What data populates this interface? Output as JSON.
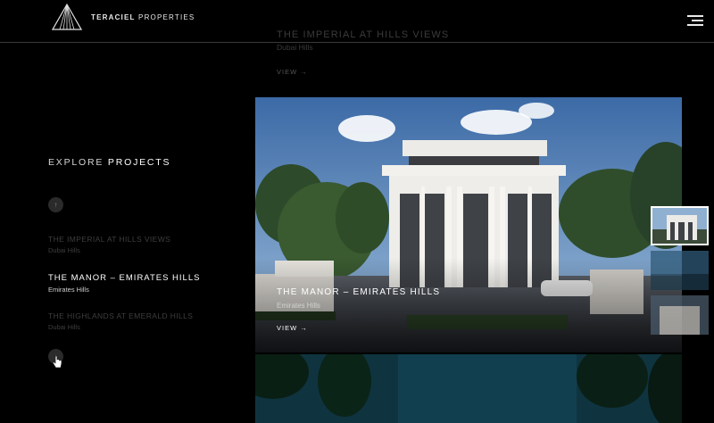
{
  "brand": {
    "name_bold": "TERACIEL",
    "name_rest": " PROPERTIES"
  },
  "header": {
    "menu_icon": "hamburger-menu-icon"
  },
  "previous_project": {
    "title": "THE IMPERIAL AT HILLS VIEWS",
    "location": "Dubai Hills",
    "view_label": "VIEW →"
  },
  "explore": {
    "word1": "EXPLORE ",
    "word2": "PROJECTS"
  },
  "nav": {
    "up_icon": "↑",
    "down_icon": "↓"
  },
  "projects": [
    {
      "title": "THE IMPERIAL AT HILLS VIEWS",
      "location": "Dubai Hills"
    },
    {
      "title": "THE MANOR – EMIRATES HILLS",
      "location": "Emirates Hills"
    },
    {
      "title": "THE HIGHLANDS AT EMERALD HILLS",
      "location": "Dubai Hills"
    }
  ],
  "featured": {
    "title": "THE MANOR – EMIRATES HILLS",
    "location": "Emirates Hills",
    "view_label": "VIEW →"
  },
  "colors": {
    "background": "#000000",
    "text_active": "#ffffff",
    "text_inactive": "#3e3e3e"
  }
}
